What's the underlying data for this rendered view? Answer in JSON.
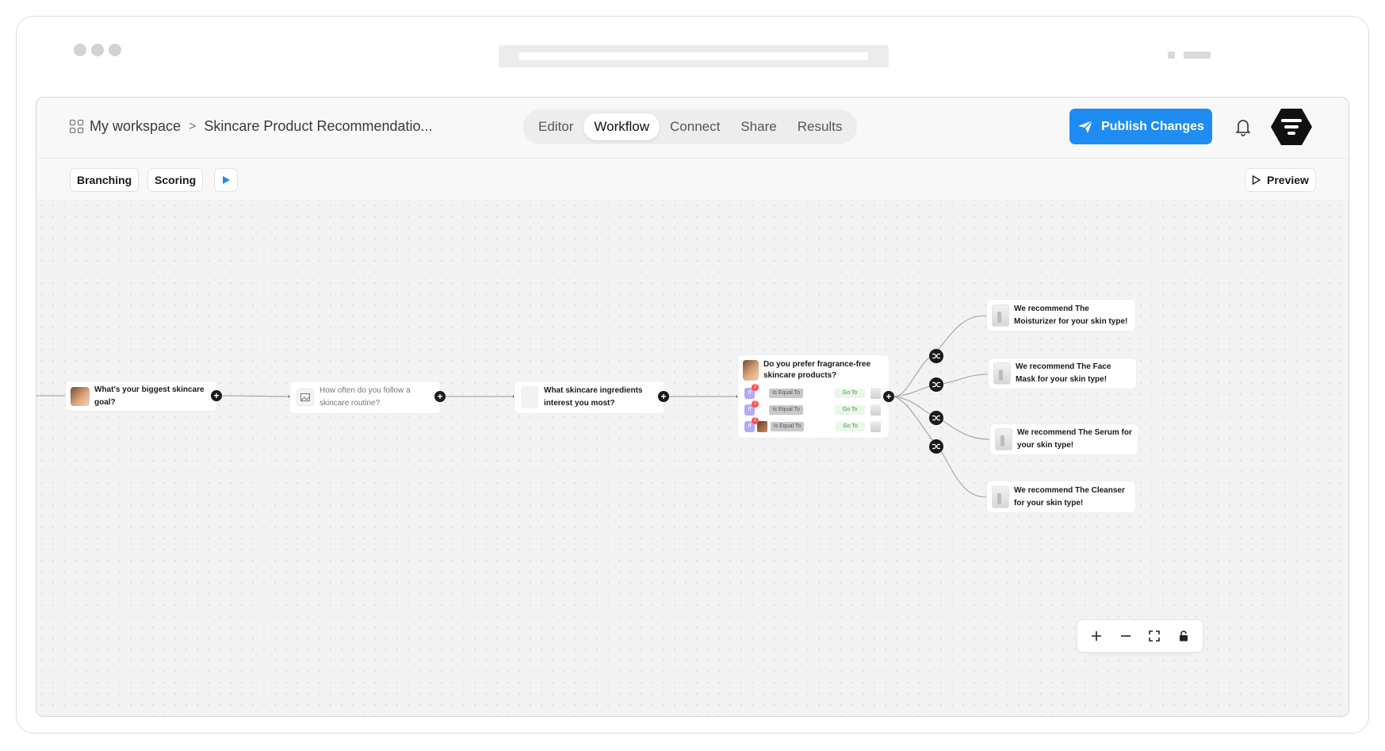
{
  "header": {
    "workspace_label": "My workspace",
    "breadcrumb_separator": ">",
    "project_title": "Skincare Product Recommendatio...",
    "tabs": [
      {
        "label": "Editor"
      },
      {
        "label": "Workflow",
        "active": true
      },
      {
        "label": "Connect"
      },
      {
        "label": "Share"
      },
      {
        "label": "Results"
      }
    ],
    "publish_label": "Publish Changes",
    "accent_color": "#1f8cf2"
  },
  "toolbar": {
    "branching_label": "Branching",
    "scoring_label": "Scoring",
    "preview_label": "Preview"
  },
  "flow": {
    "q1": "What's your biggest skincare goal?",
    "q2": "How often do you follow a skincare routine?",
    "q3": "What skincare ingredients interest you most?",
    "q4": "Do you prefer fragrance-free skincare products?",
    "branch_rows": [
      {
        "if": "If",
        "badge": "2",
        "condition": "Is Equal To",
        "action": "Go To"
      },
      {
        "if": "If",
        "badge": "2",
        "condition": "Is Equal To",
        "action": "Go To"
      },
      {
        "if": "If",
        "badge": "2",
        "condition": "Is Equal To",
        "action": "Go To"
      }
    ],
    "outcomes": [
      "We recommend The Moisturizer for your skin type!",
      "We recommend The Face Mask for your skin type!",
      "We recommend The Serum for your skin type!",
      "We recommend The Cleanser for your skin type!"
    ]
  },
  "icons": {
    "workspace": "grid-icon",
    "publish": "send-icon",
    "notifications": "bell-icon",
    "brand": "logo-icon",
    "play": "play-icon",
    "preview": "play-outline-icon",
    "branch": "shuffle-icon",
    "zoom_in": "plus-icon",
    "zoom_out": "minus-icon",
    "fit": "fit-view-icon",
    "lock": "lock-icon"
  }
}
